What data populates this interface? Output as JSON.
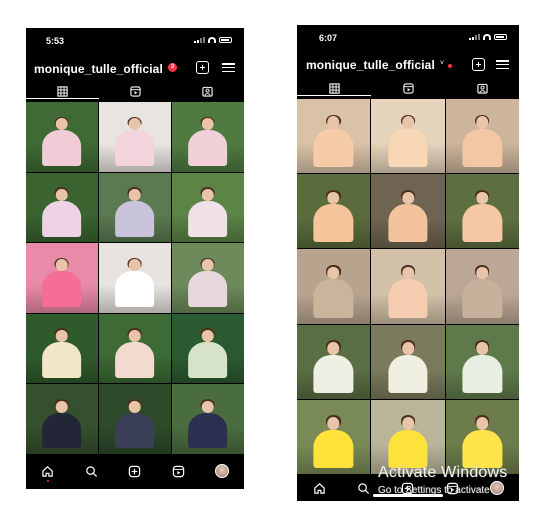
{
  "left_phone": {
    "status": {
      "time": "5:53"
    },
    "header": {
      "username": "monique_tulle_official",
      "badge_count": "3"
    },
    "tabs": [
      "grid",
      "reels",
      "tagged"
    ],
    "posts": [
      {
        "bg": "#3f6a35",
        "dress": "#f0cdd6"
      },
      {
        "bg": "#e8e4df",
        "dress": "#f3d3dc"
      },
      {
        "bg": "#4f7a40",
        "dress": "#f2d0d8"
      },
      {
        "bg": "#3a6330",
        "dress": "#ecd2e4"
      },
      {
        "bg": "#5b7a52",
        "dress": "#c9c4dc"
      },
      {
        "bg": "#5b8446",
        "dress": "#f1e2ea"
      },
      {
        "bg": "#e98aa8",
        "dress": "#f46e96"
      },
      {
        "bg": "#e7e3de",
        "dress": "#ffffff"
      },
      {
        "bg": "#6c8a5a",
        "dress": "#e9d7e0"
      },
      {
        "bg": "#2f5a2b",
        "dress": "#f2e6c8"
      },
      {
        "bg": "#3d6a35",
        "dress": "#f3dad0"
      },
      {
        "bg": "#2c5a30",
        "dress": "#d7e3c8"
      },
      {
        "bg": "#35502e",
        "dress": "#222636"
      },
      {
        "bg": "#2d4a2a",
        "dress": "#3a3e56"
      },
      {
        "bg": "#4a6d3f",
        "dress": "#2b3050"
      }
    ],
    "nav": [
      "home-icon",
      "search-icon",
      "create-icon",
      "reels-icon",
      "profile-avatar"
    ]
  },
  "right_phone": {
    "status": {
      "time": "6:07"
    },
    "header": {
      "username": "monique_tulle_official",
      "chevron": "˅"
    },
    "tabs": [
      "grid",
      "reels",
      "tagged"
    ],
    "posts": [
      {
        "bg": "#d9c2a6",
        "dress": "#f5cba8"
      },
      {
        "bg": "#e5d3bb",
        "dress": "#f8d7b6"
      },
      {
        "bg": "#cdb59c",
        "dress": "#f3c7a3"
      },
      {
        "bg": "#5a6b3c",
        "dress": "#f7c59c"
      },
      {
        "bg": "#6e6451",
        "dress": "#f2c39c"
      },
      {
        "bg": "#5d6f40",
        "dress": "#f5c7a2"
      },
      {
        "bg": "#b8a48e",
        "dress": "#c9b49c"
      },
      {
        "bg": "#d2c0a8",
        "dress": "#f4cdb0"
      },
      {
        "bg": "#bba793",
        "dress": "#c6b29c"
      },
      {
        "bg": "#5a6e44",
        "dress": "#eef0e4"
      },
      {
        "bg": "#7a7a5c",
        "dress": "#f0f0e2"
      },
      {
        "bg": "#5f7a4a",
        "dress": "#e8eee2"
      },
      {
        "bg": "#7a8a56",
        "dress": "#ffe23a"
      },
      {
        "bg": "#b9b59a",
        "dress": "#fde23c"
      },
      {
        "bg": "#6d7c4b",
        "dress": "#ffe54a"
      }
    ],
    "nav": [
      "home-icon",
      "search-icon",
      "create-icon",
      "reels-icon",
      "profile-avatar"
    ]
  },
  "watermark": {
    "title": "Activate Windows",
    "subtitle": "Go to Settings to activate"
  }
}
